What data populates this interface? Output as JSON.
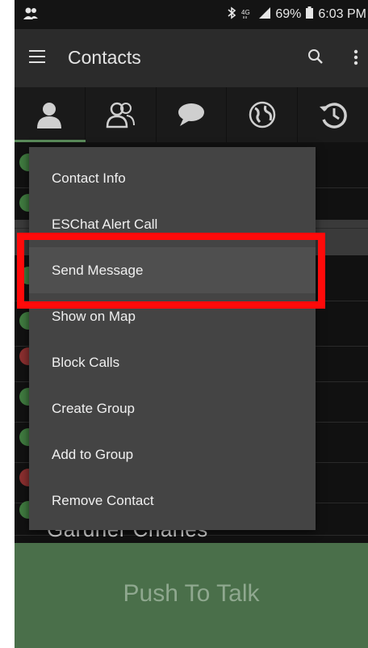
{
  "status_bar": {
    "battery": "69%",
    "time": "6:03 PM",
    "icons": [
      "contacts-notification-icon",
      "bluetooth-icon",
      "lte-icon",
      "signal-icon",
      "battery-icon"
    ]
  },
  "app_bar": {
    "title": "Contacts",
    "icons": [
      "hamburger-menu-icon",
      "search-icon",
      "overflow-menu-icon"
    ]
  },
  "tabs": [
    {
      "icon": "person-icon",
      "selected": true
    },
    {
      "icon": "group-icon",
      "selected": false
    },
    {
      "icon": "chat-bubble-icon",
      "selected": false
    },
    {
      "icon": "globe-icon",
      "selected": false
    },
    {
      "icon": "history-icon",
      "selected": false
    }
  ],
  "context_menu": {
    "items": [
      {
        "label": "Contact Info"
      },
      {
        "label": "ESChat Alert Call"
      },
      {
        "label": "Send Message",
        "highlighted": true
      },
      {
        "label": "Show on Map"
      },
      {
        "label": "Block Calls"
      },
      {
        "label": "Create Group"
      },
      {
        "label": "Add to Group"
      },
      {
        "label": "Remove Contact"
      }
    ]
  },
  "list_peek": {
    "partial_name": "Gardner Charles"
  },
  "push_to_talk": {
    "label": "Push To Talk"
  },
  "colors": {
    "accent_green": "#4a6f4a",
    "highlight_red": "#ff0a0a",
    "menu_bg": "#444444",
    "status_online": "#3f7a3f",
    "status_busy": "#8a2f2f"
  }
}
